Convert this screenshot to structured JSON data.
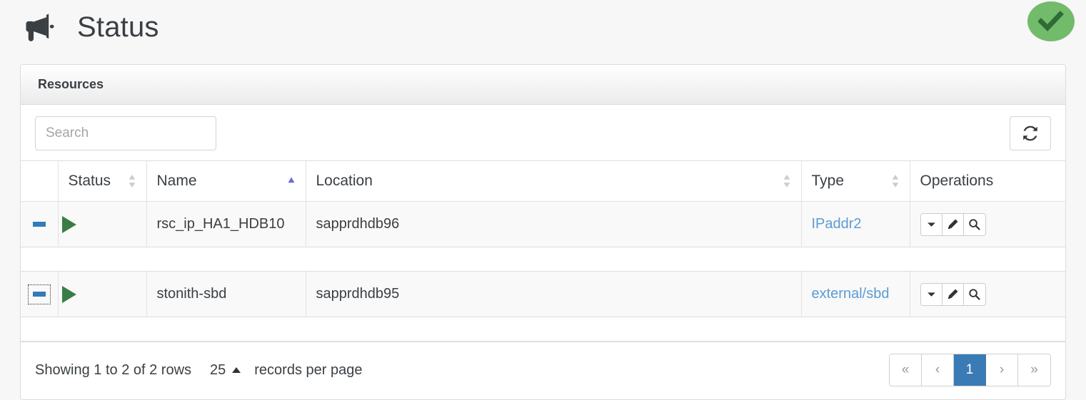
{
  "header": {
    "icon": "bullhorn-icon",
    "title": "Status",
    "status_badge": {
      "icon": "check-icon",
      "color": "#72bb6b",
      "check_color": "#2f6b34"
    }
  },
  "panel": {
    "title": "Resources"
  },
  "toolbar": {
    "search_placeholder": "Search",
    "search_value": "",
    "refresh_icon": "refresh-icon"
  },
  "table": {
    "columns": [
      {
        "key": "expand",
        "label": "",
        "sortable": false,
        "sort": "none"
      },
      {
        "key": "status",
        "label": "Status",
        "sortable": true,
        "sort": "none"
      },
      {
        "key": "name",
        "label": "Name",
        "sortable": true,
        "sort": "asc"
      },
      {
        "key": "location",
        "label": "Location",
        "sortable": true,
        "sort": "none"
      },
      {
        "key": "type",
        "label": "Type",
        "sortable": true,
        "sort": "none"
      },
      {
        "key": "operations",
        "label": "Operations",
        "sortable": false,
        "sort": "none"
      }
    ],
    "rows": [
      {
        "expander_icon": "minus-icon",
        "expander_focused": false,
        "status_icon": "play-icon",
        "status_color": "#3a7d44",
        "name": "rsc_ip_HA1_HDB10",
        "location": "sapprdhdb96",
        "type": "IPaddr2",
        "operations": [
          "caret-down-icon",
          "pencil-icon",
          "magnifier-icon"
        ]
      },
      {
        "expander_icon": "minus-icon",
        "expander_focused": true,
        "status_icon": "play-icon",
        "status_color": "#3a7d44",
        "name": "stonith-sbd",
        "location": "sapprdhdb95",
        "type": "external/sbd",
        "operations": [
          "caret-down-icon",
          "pencil-icon",
          "magnifier-icon"
        ]
      }
    ]
  },
  "footer": {
    "showing_text": "Showing 1 to 2 of 2 rows",
    "page_size": "25",
    "page_size_caret": "caret-up-icon",
    "records_label": "records per page",
    "pagination": {
      "first": "«",
      "prev": "‹",
      "pages": [
        "1"
      ],
      "active_page": "1",
      "next": "›",
      "last": "»"
    }
  },
  "colors": {
    "link": "#5b9bd5",
    "accent": "#337ab7",
    "active_page": "#3a7bb5",
    "running": "#3a7d44",
    "badge_green": "#72bb6b"
  }
}
